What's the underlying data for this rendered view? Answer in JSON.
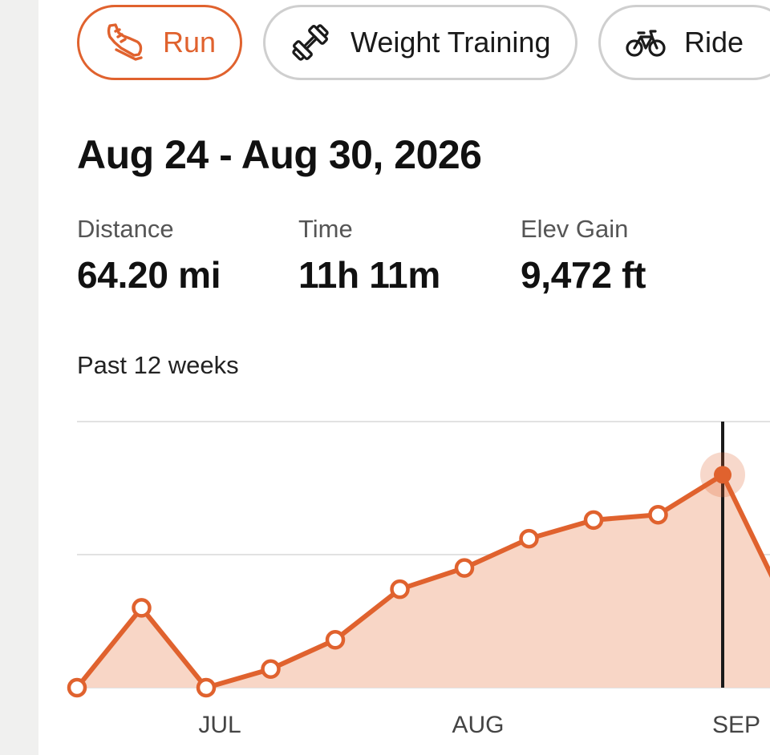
{
  "sport_tabs": [
    {
      "label": "Run",
      "icon": "shoe-icon",
      "active": true
    },
    {
      "label": "Weight Training",
      "icon": "dumbbell-icon",
      "active": false
    },
    {
      "label": "Ride",
      "icon": "bicycle-icon",
      "active": false
    }
  ],
  "week": {
    "title": "Aug 24 - Aug 30, 2026"
  },
  "stats": {
    "distance": {
      "label": "Distance",
      "value": "64.20 mi"
    },
    "time": {
      "label": "Time",
      "value": "11h 11m"
    },
    "elev_gain": {
      "label": "Elev Gain",
      "value": "9,472 ft"
    }
  },
  "range_label": "Past 12 weeks",
  "colors": {
    "accent": "#e0622e",
    "fill": "#f8d6c6",
    "grid": "#e2e2e2",
    "cursor": "#1a1a1a"
  },
  "chart_data": {
    "type": "area",
    "title": "",
    "xlabel": "",
    "ylabel": "",
    "x_ticks": [
      "JUL",
      "AUG",
      "SEP"
    ],
    "ylim": [
      0,
      100
    ],
    "grid": true,
    "series": [
      {
        "values": [
          0,
          30,
          0,
          7,
          18,
          37,
          45,
          56,
          63,
          65,
          80,
          30
        ]
      }
    ],
    "selected_index": 10
  }
}
